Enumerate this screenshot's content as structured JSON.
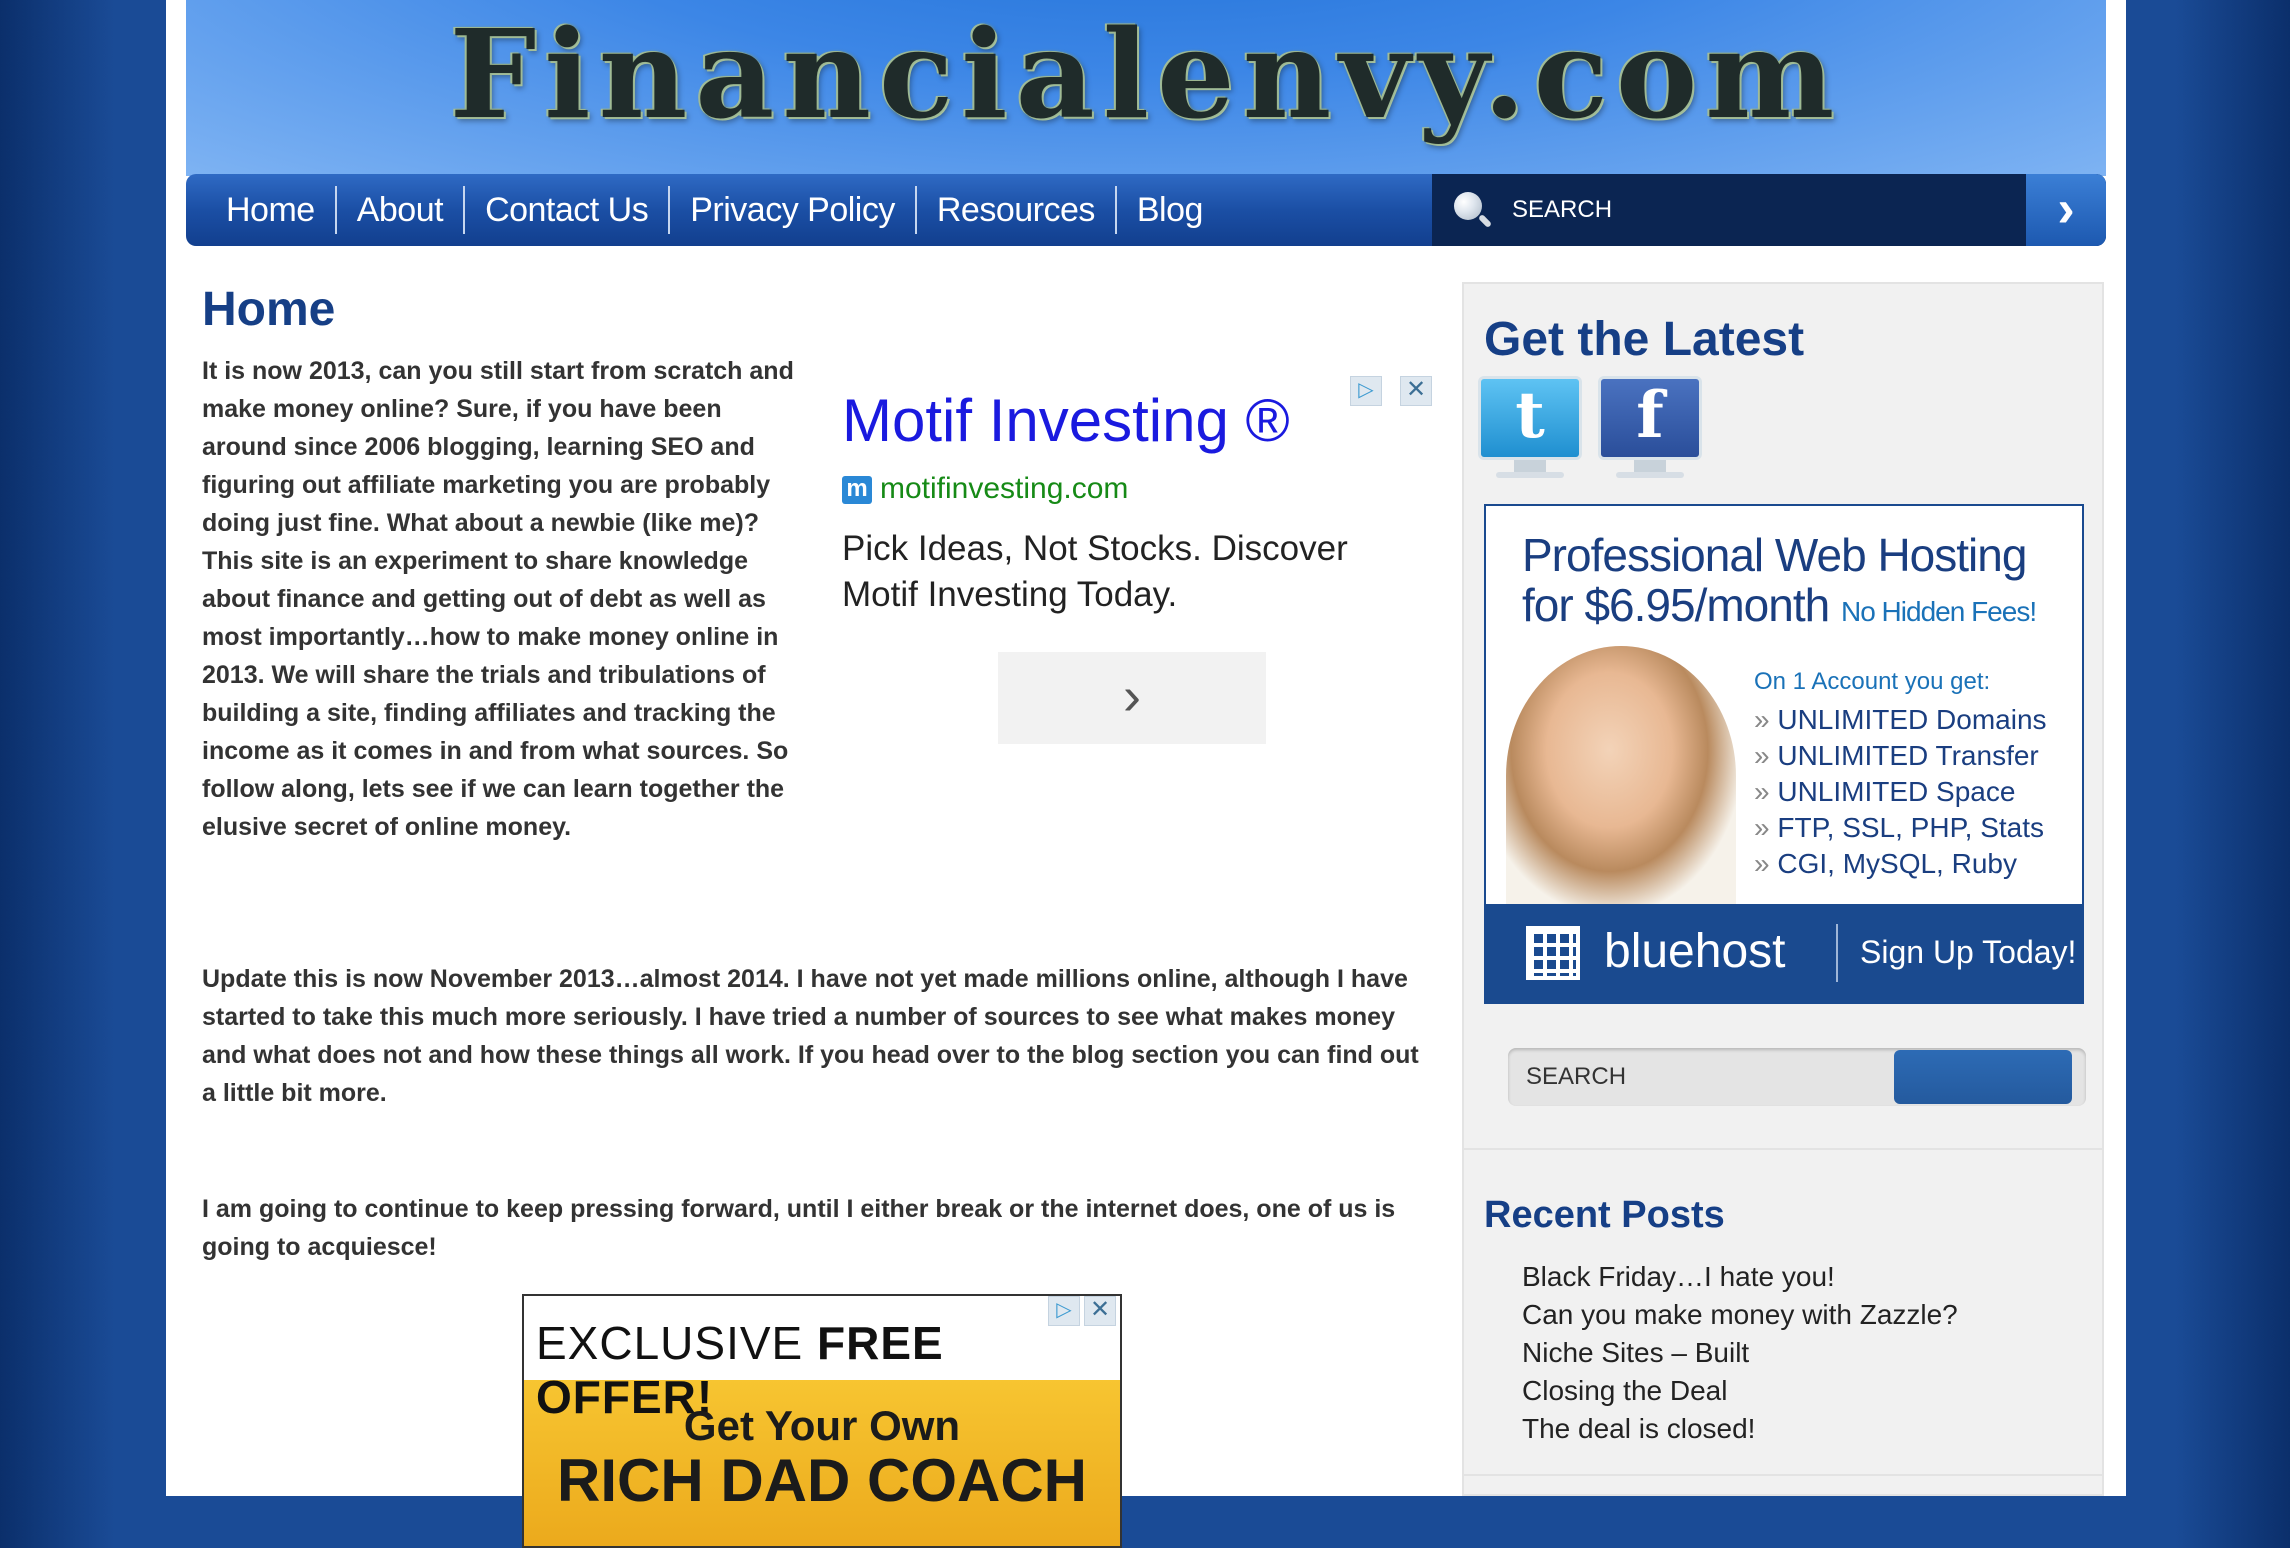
{
  "header": {
    "logo_text": "Financialenvy.com"
  },
  "nav": {
    "items": [
      "Home",
      "About",
      "Contact Us",
      "Privacy Policy",
      "Resources",
      "Blog"
    ],
    "search_label": "SEARCH",
    "search_go_icon": "chevron-right-icon"
  },
  "main": {
    "title": "Home",
    "intro": "It is now 2013, can you still start from scratch and make money online? Sure, if you have been around since 2006 blogging, learning SEO and figuring out affiliate marketing you are probably doing just fine. What about a newbie (like me)? This site is an experiment to share knowledge about finance and getting out of debt as well as most importantly…how to make money online in 2013. We will share the trials and tribulations of building a site, finding affiliates and tracking the income as it comes in and from what sources. So follow along, lets see if we can learn together the elusive secret of online money.",
    "update": "Update this is now November 2013…almost 2014. I have not yet made millions online, although I have started to take this much more seriously. I have tried a number of sources to see what makes money and what does not and how these things all work. If you head over to the blog section you can find out a little bit more.",
    "forward": "I am going to continue to keep pressing forward, until I either break or the internet does, one of us is going to acquiesce!"
  },
  "ad_motif": {
    "title": "Motif Investing ®",
    "url_icon": "m",
    "url": "motifinvesting.com",
    "description": "Pick Ideas, Not Stocks. Discover Motif Investing Today.",
    "go_glyph": "›",
    "close_glyph": "✕"
  },
  "ad_richdad": {
    "headline_plain": "EXCLUSIVE ",
    "headline_bold": "FREE OFFER!",
    "line1": "Get Your Own",
    "line2": "RICH DAD COACH",
    "close_glyph": "✕"
  },
  "sidebar": {
    "latest_title": "Get the Latest",
    "social": [
      {
        "name": "twitter",
        "glyph": "t"
      },
      {
        "name": "facebook",
        "glyph": "f"
      }
    ],
    "hosting_ad": {
      "headline1": "Professional Web Hosting",
      "price": "for $6.95/month",
      "no_fees": "No Hidden Fees!",
      "list_title": "On 1 Account you get:",
      "list": [
        "UNLIMITED Domains",
        "UNLIMITED Transfer",
        "UNLIMITED Space",
        "FTP, SSL, PHP, Stats",
        "CGI, MySQL, Ruby"
      ],
      "brand": "bluehost",
      "cta": "Sign Up Today!"
    },
    "search_placeholder": "SEARCH",
    "recent_title": "Recent Posts",
    "recent_posts": [
      "Black Friday…I hate you!",
      "Can you make money with Zazzle?",
      "Niche Sites – Built",
      "Closing the Deal",
      "The deal is closed!"
    ]
  },
  "colors": {
    "background": "#1a4b96",
    "nav": "#1b4fa5",
    "heading": "#163f86",
    "link_green": "#168a16",
    "ad_blue": "#1a1adf"
  }
}
